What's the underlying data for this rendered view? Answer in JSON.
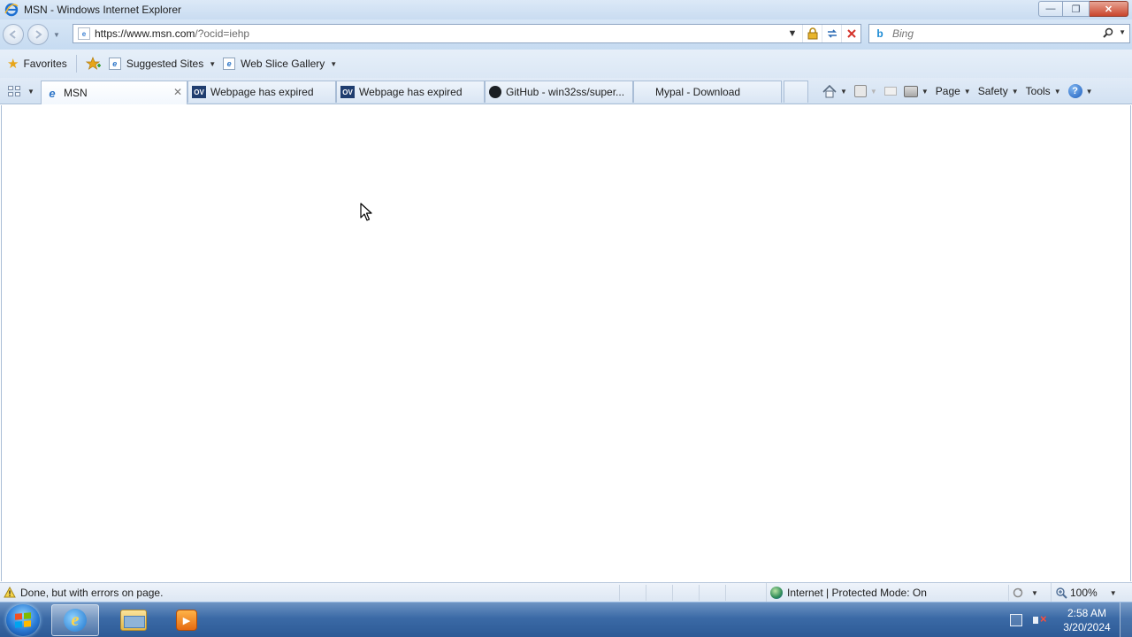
{
  "window": {
    "title": "MSN - Windows Internet Explorer",
    "controls": {
      "minimize": "—",
      "restore": "❐",
      "close": "✕"
    }
  },
  "navigation": {
    "back_icon": "back-arrow",
    "forward_icon": "forward-arrow",
    "url_host": "https://www.msn.com",
    "url_rest": "/?ocid=iehp",
    "security_icon": "lock",
    "refresh_icon": "refresh",
    "stop_icon": "stop-x"
  },
  "search": {
    "placeholder": "Bing"
  },
  "favorites_bar": {
    "favorites_label": "Favorites",
    "items": [
      {
        "label": "Suggested Sites"
      },
      {
        "label": "Web Slice Gallery"
      }
    ]
  },
  "tabs": [
    {
      "title": "MSN",
      "favicon": "ie",
      "active": true
    },
    {
      "title": "Webpage has expired",
      "favicon": "ov",
      "active": false
    },
    {
      "title": "Webpage has expired",
      "favicon": "ov",
      "active": false
    },
    {
      "title": "GitHub - win32ss/super...",
      "favicon": "github",
      "active": false
    },
    {
      "title": "Mypal - Download",
      "favicon": "none",
      "active": false
    }
  ],
  "favicon_ov_text": "OV",
  "command_bar": {
    "page_label": "Page",
    "safety_label": "Safety",
    "tools_label": "Tools",
    "help_glyph": "?"
  },
  "status_bar": {
    "message": "Done, but with errors on page.",
    "zone": "Internet | Protected Mode: On",
    "zoom": "100%"
  },
  "taskbar": {
    "apps": [
      {
        "name": "Internet Explorer",
        "active": true
      },
      {
        "name": "Windows Explorer",
        "active": false
      },
      {
        "name": "Windows Media Player",
        "active": false
      }
    ],
    "time": "2:58 AM",
    "date": "3/20/2024"
  },
  "colors": {
    "chrome_blue": "#c9dcf1",
    "taskbar_blue": "#3b6aa6",
    "close_red": "#c9452c"
  }
}
